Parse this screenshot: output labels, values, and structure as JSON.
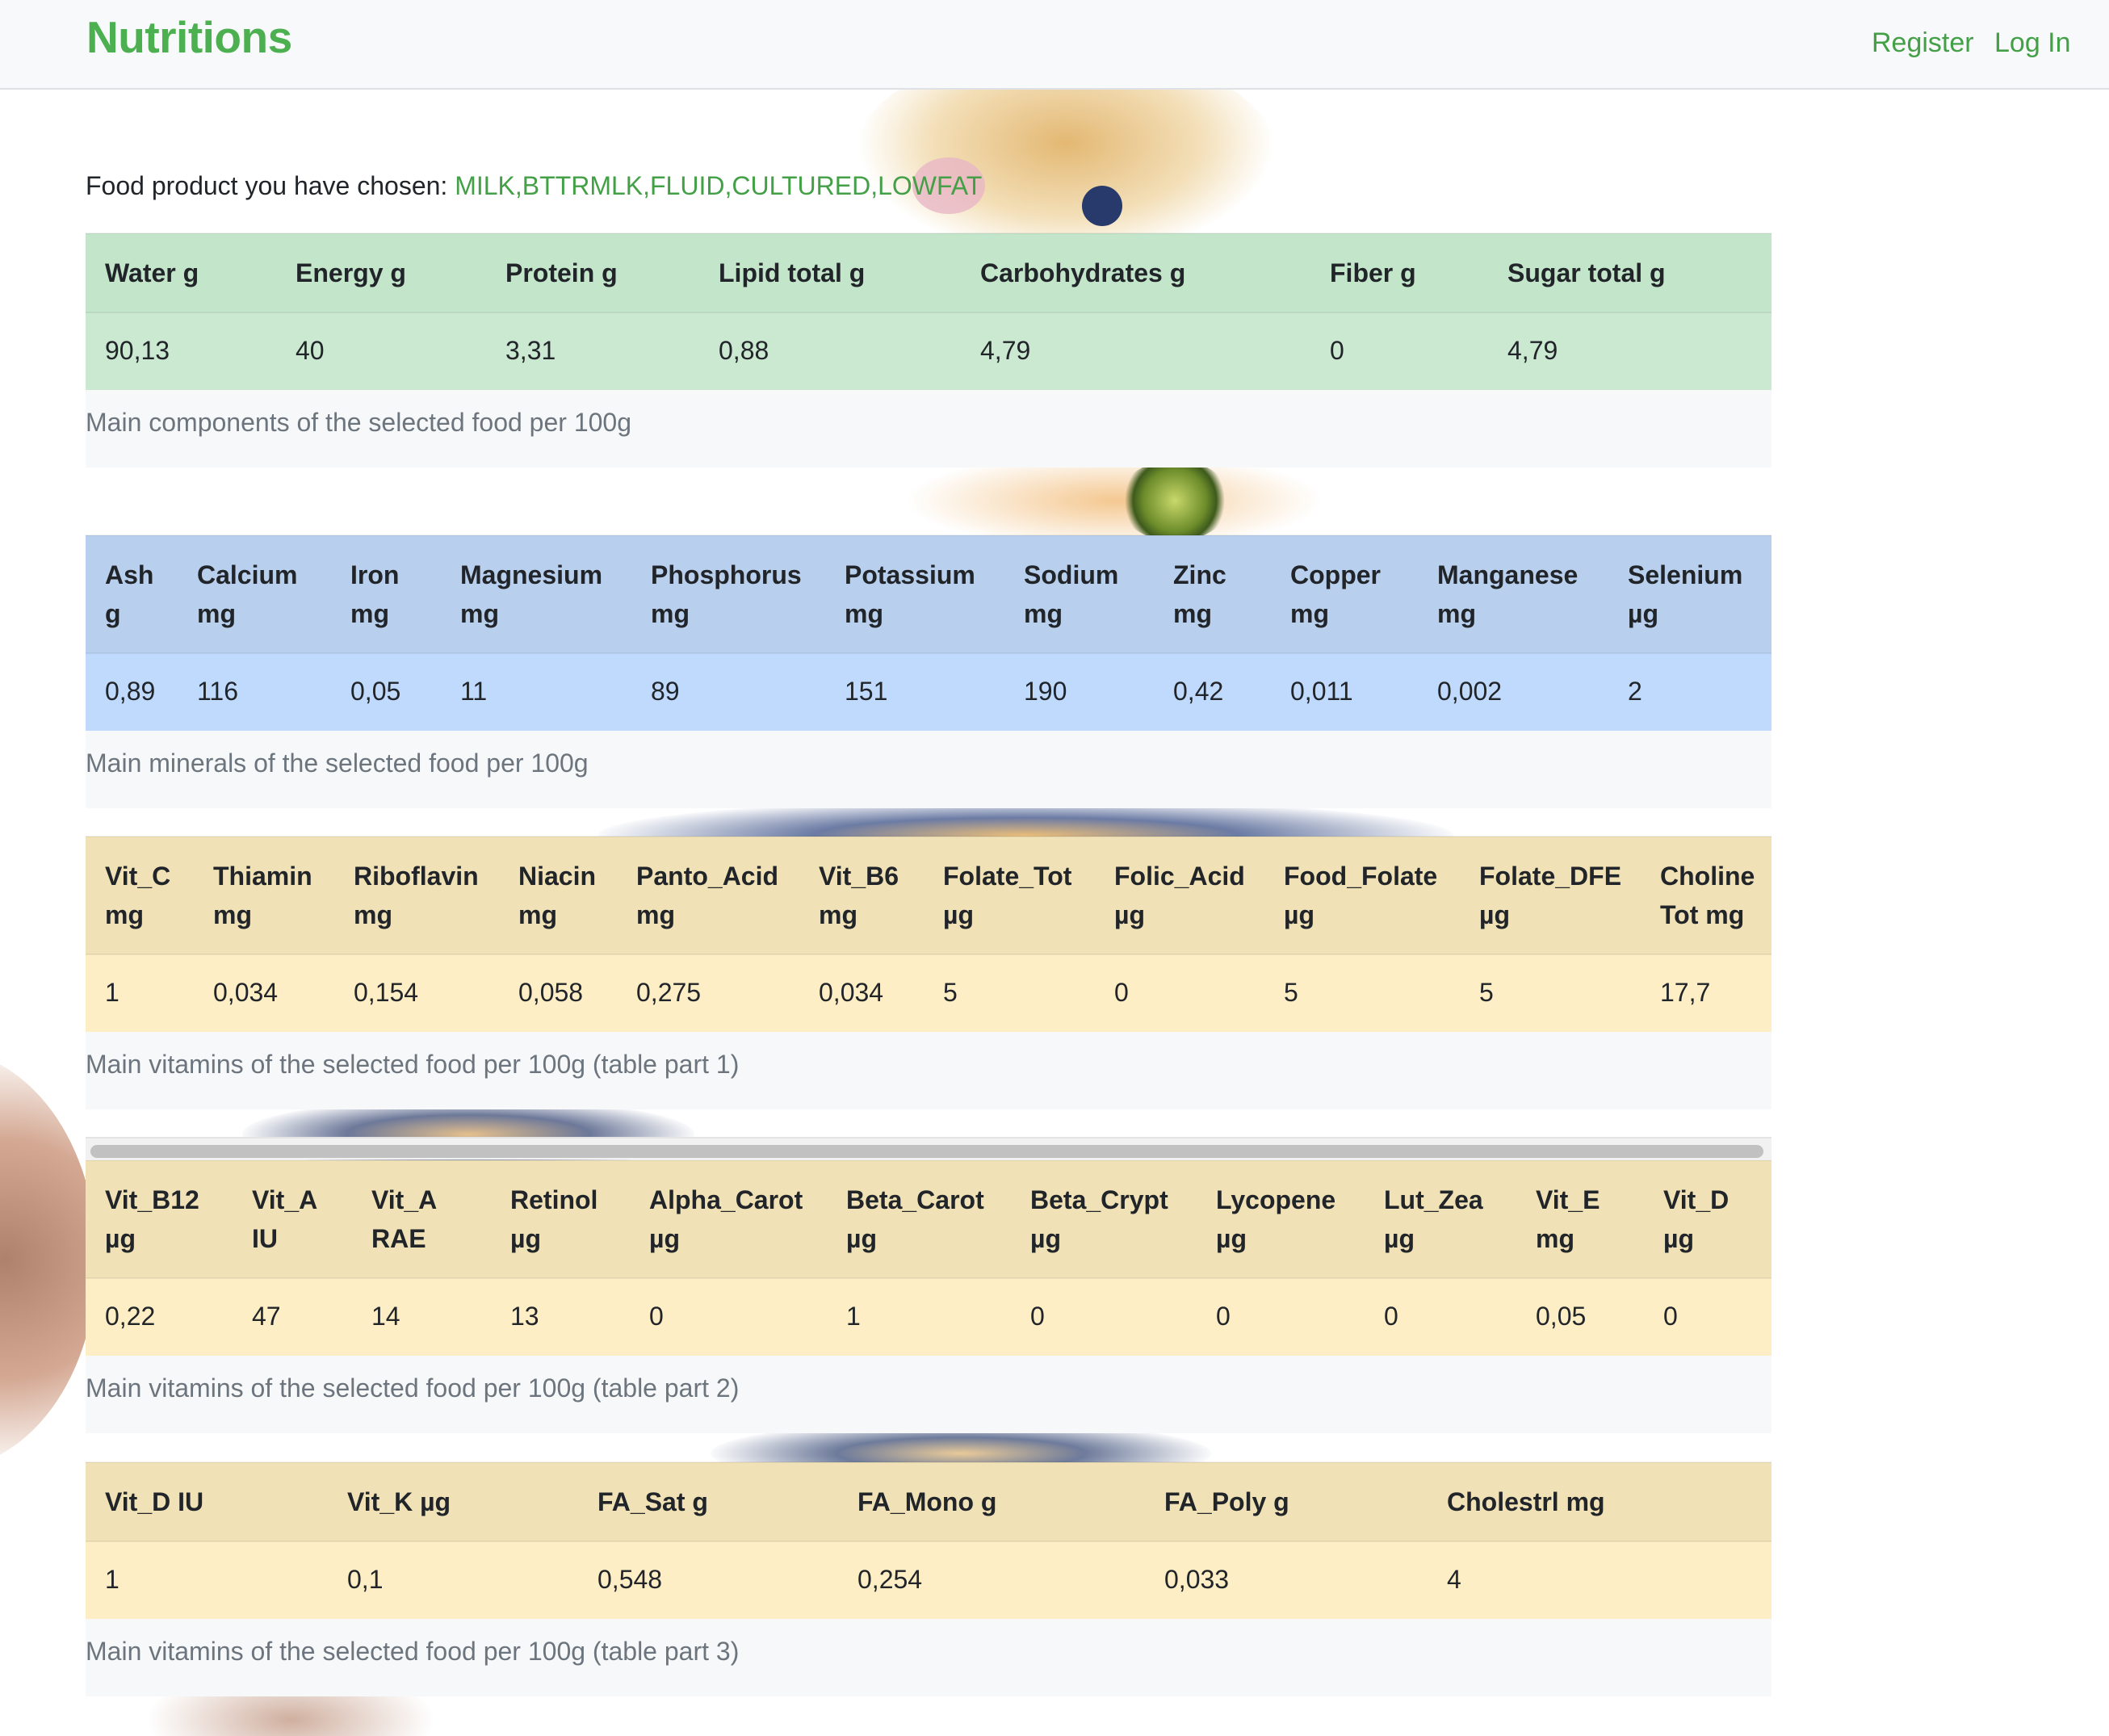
{
  "navbar": {
    "brand": "Nutritions",
    "register": "Register",
    "login": "Log In"
  },
  "selection": {
    "label": "Food product you have chosen: ",
    "food": "MILK,BTTRMLK,FLUID,CULTURED,LOWFAT"
  },
  "colors": {
    "brand": "#4caf50",
    "components_table": "#c3e6cb",
    "minerals_table": "#b8daff",
    "vitamins_table": "#ffeeba"
  },
  "tables": {
    "components": {
      "headers": [
        "Water g",
        "Energy g",
        "Protein g",
        "Lipid total g",
        "Carbohydrates g",
        "Fiber g",
        "Sugar total g"
      ],
      "values": [
        "90,13",
        "40",
        "3,31",
        "0,88",
        "4,79",
        "0",
        "4,79"
      ],
      "caption": "Main components of the selected food per 100g"
    },
    "minerals": {
      "headers": [
        "Ash g",
        "Calcium mg",
        "Iron mg",
        "Magnesium mg",
        "Phosphorus mg",
        "Potassium mg",
        "Sodium mg",
        "Zinc mg",
        "Copper mg",
        "Manganese mg",
        "Selenium µg"
      ],
      "values": [
        "0,89",
        "116",
        "0,05",
        "11",
        "89",
        "151",
        "190",
        "0,42",
        "0,011",
        "0,002",
        "2"
      ],
      "caption": "Main minerals of the selected food per 100g"
    },
    "vitamins1": {
      "headers": [
        "Vit_C mg",
        "Thiamin mg",
        "Riboflavin mg",
        "Niacin mg",
        "Panto_Acid mg",
        "Vit_B6 mg",
        "Folate_Tot µg",
        "Folic_Acid µg",
        "Food_Folate µg",
        "Folate_DFE µg",
        "Choline Tot mg"
      ],
      "values": [
        "1",
        "0,034",
        "0,154",
        "0,058",
        "0,275",
        "0,034",
        "5",
        "0",
        "5",
        "5",
        "17,7"
      ],
      "caption": "Main vitamins of the selected food per 100g (table part 1)"
    },
    "vitamins2": {
      "headers": [
        "Vit_B12 µg",
        "Vit_A IU",
        "Vit_A RAE",
        "Retinol µg",
        "Alpha_Carot µg",
        "Beta_Carot µg",
        "Beta_Crypt µg",
        "Lycopene µg",
        "Lut_Zea µg",
        "Vit_E mg",
        "Vit_D µg"
      ],
      "values": [
        "0,22",
        "47",
        "14",
        "13",
        "0",
        "1",
        "0",
        "0",
        "0",
        "0,05",
        "0"
      ],
      "caption": "Main vitamins of the selected food per 100g (table part 2)"
    },
    "vitamins3": {
      "headers": [
        "Vit_D IU",
        "Vit_K µg",
        "FA_Sat g",
        "FA_Mono g",
        "FA_Poly g",
        "Cholestrl mg"
      ],
      "values": [
        "1",
        "0,1",
        "0,548",
        "0,254",
        "0,033",
        "4"
      ],
      "caption": "Main vitamins of the selected food per 100g (table part 3)"
    }
  }
}
